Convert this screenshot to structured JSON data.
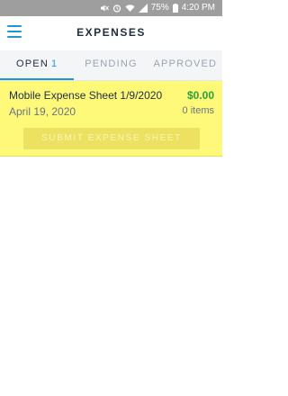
{
  "status_bar": {
    "battery": "75%",
    "time": "4:20 PM"
  },
  "header": {
    "title": "EXPENSES",
    "menu_icon": "hamburger-menu-icon"
  },
  "tabs": [
    {
      "label": "OPEN",
      "count": "1",
      "active": true
    },
    {
      "label": "PENDING",
      "count": "",
      "active": false
    },
    {
      "label": "APPROVED",
      "count": "",
      "active": false
    }
  ],
  "expense_sheet": {
    "name": "Mobile Expense Sheet 1/9/2020",
    "amount": "$0.00",
    "date": "April 19, 2020",
    "items": "0 items",
    "submit_label": "SUBMIT EXPENSE SHEET"
  },
  "colors": {
    "accent": "#2196d3",
    "card_background": "#fff97a",
    "amount_green": "#2e9d3a",
    "status_bar": "#9e9e9e"
  }
}
